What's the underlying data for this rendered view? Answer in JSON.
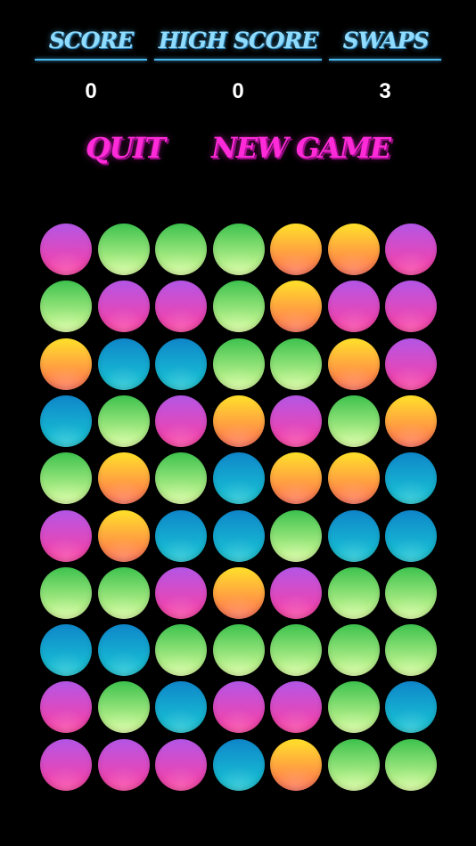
{
  "hud": {
    "score_label": "SCORE",
    "high_score_label": "HIGH SCORE",
    "swaps_label": "SWAPS",
    "score": "0",
    "high_score": "0",
    "swaps": "3"
  },
  "menu": {
    "quit_label": "QUIT",
    "new_game_label": "NEW GAME"
  },
  "colors": {
    "purple": [
      "#b356e6",
      "#ff3fa0"
    ],
    "green": [
      "#3ec24e",
      "#d9ff9c"
    ],
    "orange": [
      "#ffe12a",
      "#ff6d52"
    ],
    "blue": [
      "#0f86c9",
      "#19c9d6"
    ]
  },
  "board": {
    "rows": 10,
    "cols": 7,
    "grid": [
      [
        "purple",
        "green",
        "green",
        "green",
        "orange",
        "orange",
        "purple"
      ],
      [
        "green",
        "purple",
        "purple",
        "green",
        "orange",
        "purple",
        "purple"
      ],
      [
        "orange",
        "blue",
        "blue",
        "green",
        "green",
        "orange",
        "purple"
      ],
      [
        "blue",
        "green",
        "purple",
        "orange",
        "purple",
        "green",
        "orange"
      ],
      [
        "green",
        "orange",
        "green",
        "blue",
        "orange",
        "orange",
        "blue"
      ],
      [
        "purple",
        "orange",
        "blue",
        "blue",
        "green",
        "blue",
        "blue"
      ],
      [
        "green",
        "green",
        "purple",
        "orange",
        "purple",
        "green",
        "green"
      ],
      [
        "blue",
        "blue",
        "green",
        "green",
        "green",
        "green",
        "green"
      ],
      [
        "purple",
        "green",
        "blue",
        "purple",
        "purple",
        "green",
        "blue"
      ],
      [
        "purple",
        "purple",
        "purple",
        "blue",
        "orange",
        "green",
        "green"
      ]
    ]
  }
}
